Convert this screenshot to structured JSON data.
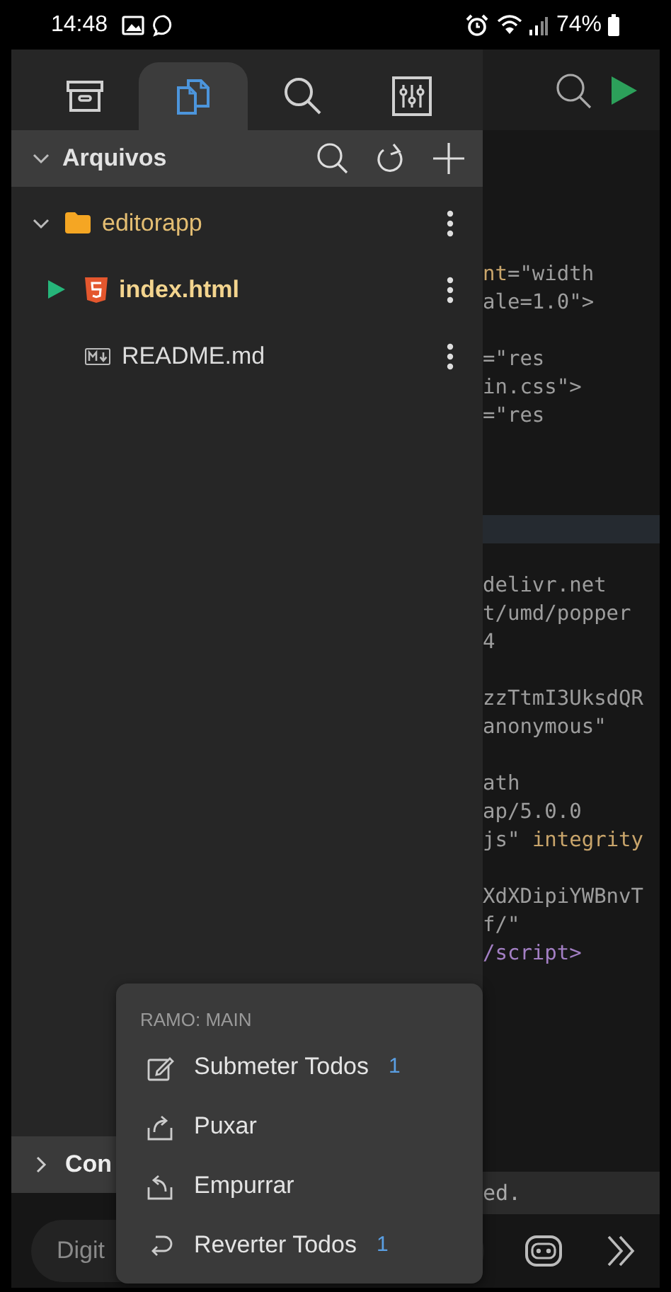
{
  "status_bar": {
    "time": "14:48",
    "battery": "74%"
  },
  "sidebar": {
    "tabs": [
      {
        "kind": "archive",
        "selected": false
      },
      {
        "kind": "files",
        "selected": true
      },
      {
        "kind": "search",
        "selected": false
      },
      {
        "kind": "settings",
        "selected": false
      }
    ],
    "section": {
      "title": "Arquivos",
      "expanded": true
    },
    "tree": [
      {
        "name": "editorapp",
        "kind": "folder",
        "expanded": true,
        "children": [
          {
            "name": "index.html",
            "kind": "html",
            "selected": true
          },
          {
            "name": "README.md",
            "kind": "markdown",
            "selected": false
          }
        ]
      }
    ],
    "bottom_section": {
      "title": "Con",
      "expanded": false
    }
  },
  "editor": {
    "lines": [
      {
        "kind": "code",
        "tokens": [
          {
            "text": "nt",
            "kind": "attr"
          },
          {
            "text": "=\"width",
            "kind": "string"
          }
        ]
      },
      {
        "kind": "code",
        "tokens": [
          {
            "text": "ale=1.0\">",
            "kind": "string"
          }
        ]
      },
      {
        "kind": "blank"
      },
      {
        "kind": "code",
        "tokens": [
          {
            "text": "=\"res",
            "kind": "string"
          }
        ]
      },
      {
        "kind": "code",
        "tokens": [
          {
            "text": "in.css\">",
            "kind": "string"
          }
        ]
      },
      {
        "kind": "code",
        "tokens": [
          {
            "text": "=\"res",
            "kind": "string"
          }
        ]
      },
      {
        "kind": "blank"
      },
      {
        "kind": "blank"
      },
      {
        "kind": "blank"
      },
      {
        "kind": "current"
      },
      {
        "kind": "blank"
      },
      {
        "kind": "code",
        "tokens": [
          {
            "text": "delivr.net",
            "kind": "string"
          }
        ]
      },
      {
        "kind": "code",
        "tokens": [
          {
            "text": "t/umd/popper",
            "kind": "string"
          }
        ]
      },
      {
        "kind": "code",
        "tokens": [
          {
            "text": "4",
            "kind": "string"
          }
        ]
      },
      {
        "kind": "blank"
      },
      {
        "kind": "code",
        "tokens": [
          {
            "text": "zzTtmI3UksdQR",
            "kind": "string"
          }
        ]
      },
      {
        "kind": "code",
        "tokens": [
          {
            "text": "anonymous\"",
            "kind": "string"
          }
        ]
      },
      {
        "kind": "blank"
      },
      {
        "kind": "code",
        "tokens": [
          {
            "text": "ath",
            "kind": "string"
          }
        ]
      },
      {
        "kind": "code",
        "tokens": [
          {
            "text": "ap/5.0.0",
            "kind": "string"
          }
        ]
      },
      {
        "kind": "code",
        "tokens": [
          {
            "text": "js\"",
            "kind": "string"
          },
          {
            "text": "integrity",
            "kind": "attr"
          }
        ]
      },
      {
        "kind": "blank"
      },
      {
        "kind": "code",
        "tokens": [
          {
            "text": "XdXDipiYWBnvT",
            "kind": "string"
          }
        ]
      },
      {
        "kind": "code",
        "tokens": [
          {
            "text": "f/\"",
            "kind": "string"
          }
        ]
      },
      {
        "kind": "code",
        "tokens": [
          {
            "text": "/script>",
            "kind": "tag"
          }
        ]
      }
    ],
    "status": "ed."
  },
  "input": {
    "placeholder": "Digit"
  },
  "menu": {
    "title": "RAMO: MAIN",
    "items": [
      {
        "label": "Submeter Todos",
        "kind": "commit",
        "badge": "1"
      },
      {
        "label": "Puxar",
        "kind": "pull"
      },
      {
        "label": "Empurrar",
        "kind": "push"
      },
      {
        "label": "Reverter Todos",
        "kind": "revert",
        "badge": "1"
      }
    ]
  }
}
